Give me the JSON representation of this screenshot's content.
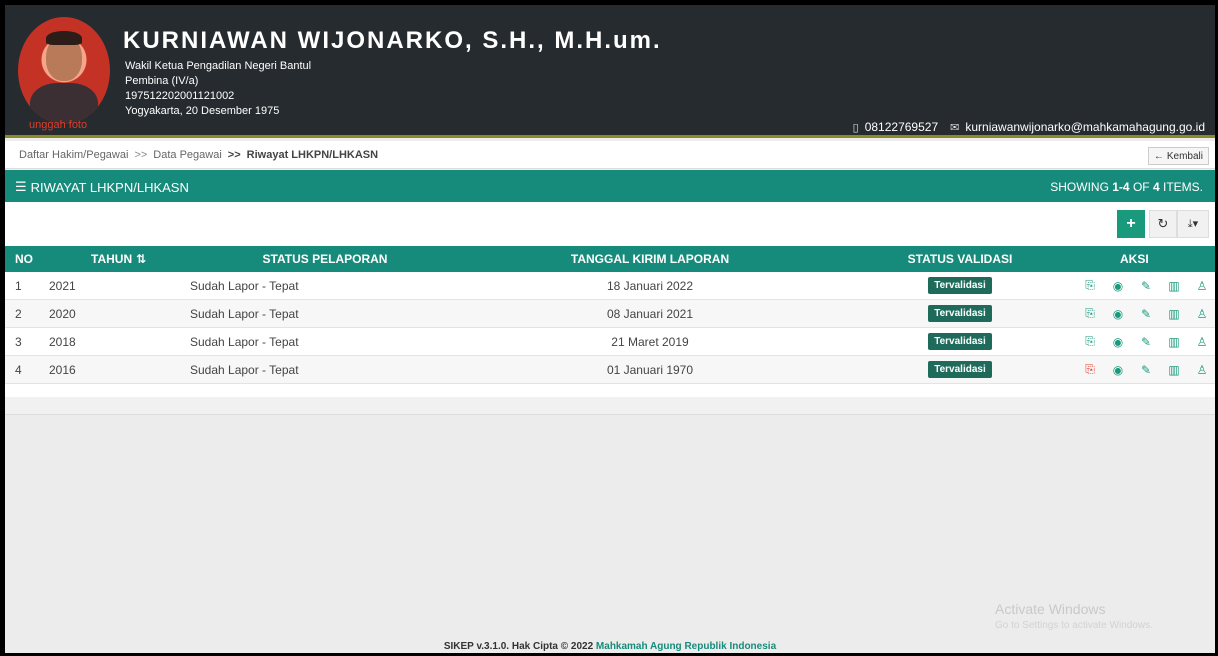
{
  "profile": {
    "name": "KURNIAWAN WIJONARKO, S.H., M.H.um.",
    "position": "Wakil Ketua Pengadilan Negeri Bantul",
    "rank": "Pembina (IV/a)",
    "nip": "197512202001121002",
    "birth": "Yogyakarta, 20 Desember 1975",
    "upload_label": "unggah foto",
    "phone": "08122769527",
    "email": "kurniawanwijonarko@mahkamahagung.go.id"
  },
  "breadcrumb": {
    "items": [
      "Daftar Hakim/Pegawai",
      "Data Pegawai",
      "Riwayat LHKPN/LHKASN"
    ],
    "separator": ">>",
    "back_label": "Kembali"
  },
  "panel": {
    "title": "RIWAYAT LHKPN/LHKASN",
    "summary_prefix": "SHOWING",
    "summary_range": "1-4",
    "summary_mid": "OF",
    "summary_total": "4",
    "summary_suffix": "ITEMS."
  },
  "table": {
    "headers": {
      "no": "NO",
      "tahun": "TAHUN",
      "status": "STATUS PELAPORAN",
      "tanggal": "TANGGAL KIRIM LAPORAN",
      "validasi": "STATUS VALIDASI",
      "aksi": "AKSI"
    },
    "rows": [
      {
        "no": "1",
        "tahun": "2021",
        "status": "Sudah Lapor - Tepat",
        "tanggal": "18 Januari 2022",
        "validasi": "Tervalidasi",
        "pdf_color": "green"
      },
      {
        "no": "2",
        "tahun": "2020",
        "status": "Sudah Lapor - Tepat",
        "tanggal": "08 Januari 2021",
        "validasi": "Tervalidasi",
        "pdf_color": "green"
      },
      {
        "no": "3",
        "tahun": "2018",
        "status": "Sudah Lapor - Tepat",
        "tanggal": "21 Maret 2019",
        "validasi": "Tervalidasi",
        "pdf_color": "green"
      },
      {
        "no": "4",
        "tahun": "2016",
        "status": "Sudah Lapor - Tepat",
        "tanggal": "01 Januari 1970",
        "validasi": "Tervalidasi",
        "pdf_color": "red"
      }
    ]
  },
  "watermark": {
    "line1": "Activate Windows",
    "line2": "Go to Settings to activate Windows."
  },
  "footer": {
    "text": "SIKEP v.3.1.0. Hak Cipta © 2022",
    "link": "Mahkamah Agung Republik Indonesia"
  },
  "colors": {
    "header_bg": "#252b2f",
    "accent": "#178b7b",
    "badge": "#1f6b5b",
    "pdf_red": "#e23c2a"
  }
}
